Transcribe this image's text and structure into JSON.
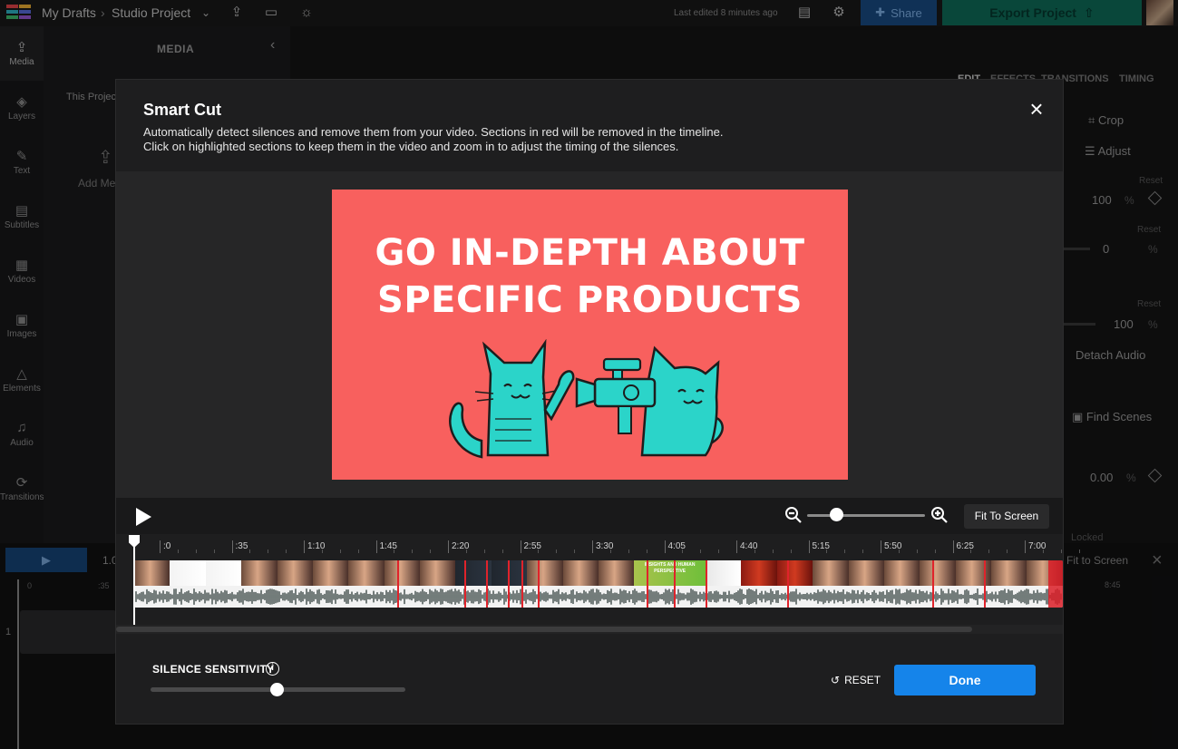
{
  "topbar": {
    "breadcrumb_root": "My Drafts",
    "breadcrumb_sep": "›",
    "project_name": "Studio Project",
    "last_edited": "Last edited 8 minutes ago",
    "share_label": "Share",
    "export_label": "Export Project"
  },
  "rail": {
    "items": [
      {
        "label": "Media",
        "icon": "upload-icon"
      },
      {
        "label": "Layers",
        "icon": "layers-icon"
      },
      {
        "label": "Text",
        "icon": "text-icon"
      },
      {
        "label": "Subtitles",
        "icon": "subtitles-icon"
      },
      {
        "label": "Videos",
        "icon": "film-icon"
      },
      {
        "label": "Images",
        "icon": "image-icon"
      },
      {
        "label": "Elements",
        "icon": "shapes-icon"
      },
      {
        "label": "Audio",
        "icon": "music-icon"
      },
      {
        "label": "Transitions",
        "icon": "transition-icon"
      }
    ]
  },
  "media_panel": {
    "title": "MEDIA",
    "this_project": "This Projec",
    "add_media": "Add Me"
  },
  "right_panel": {
    "tabs": [
      "EDIT",
      "EFFECTS",
      "TRANSITIONS",
      "TIMING"
    ],
    "crop": "Crop",
    "adjust": "Adjust",
    "reset": "Reset",
    "val1": "100",
    "val2": "0",
    "val3": "100",
    "pct": "%",
    "detach_audio": "Detach Audio",
    "find_scenes": "Find Scenes",
    "val4": "0.00"
  },
  "bottom": {
    "time": "1.0",
    "ruler_0": "0",
    "ruler_35": ":35",
    "track_num": "1",
    "locked": "Locked",
    "fit": "Fit to Screen",
    "time_right": "8:45"
  },
  "modal": {
    "title": "Smart Cut",
    "description_1": "Automatically detect silences and remove them from your video. Sections in red will be removed in the timeline.",
    "description_2": "Click on highlighted sections to keep them in the video and zoom in to adjust the timing of the silences.",
    "video_headline_1": "GO IN-DEPTH ABOUT",
    "video_headline_2": "SPECIFIC PRODUCTS",
    "fit_to_screen": "Fit To Screen",
    "zoom_level": 0.2,
    "ruler_labels": [
      ":0",
      ":35",
      "1:10",
      "1:45",
      "2:20",
      "2:55",
      "3:30",
      "4:05",
      "4:40",
      "5:15",
      "5:50",
      "6:25",
      "7:00"
    ],
    "thumb_caption": "INSIGHTS AND HUMAN PERSPECTIVE",
    "silence_sensitivity_label": "SILENCE SENSITIVITY",
    "silence_sensitivity": 0.5,
    "reset_label": "RESET",
    "done_label": "Done"
  },
  "colors": {
    "accent_blue": "#1584ea",
    "export_green": "#0e6e59",
    "silence_red": "#e0232b",
    "video_bg": "#f8605e",
    "cat_teal": "#2bd4c9"
  }
}
